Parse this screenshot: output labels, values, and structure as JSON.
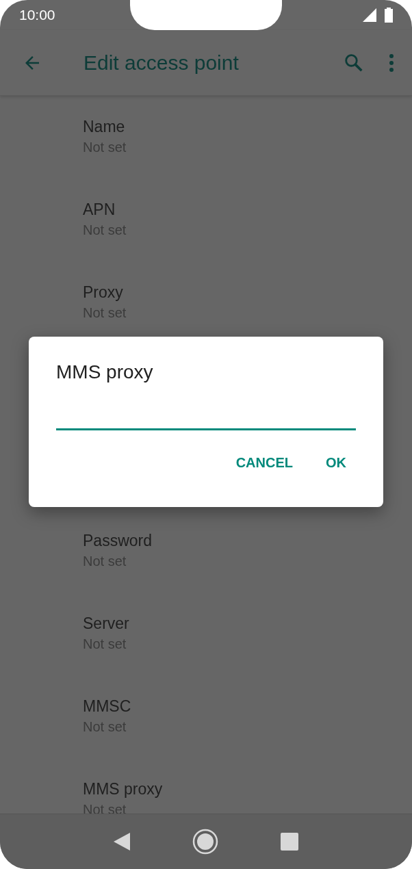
{
  "status_bar": {
    "time": "10:00"
  },
  "app_bar": {
    "title": "Edit access point"
  },
  "settings_above_dialog": [
    {
      "label": "Name",
      "value": "Not set"
    },
    {
      "label": "APN",
      "value": "Not set"
    },
    {
      "label": "Proxy",
      "value": "Not set"
    }
  ],
  "settings_below_dialog": [
    {
      "label": "Password",
      "value": "Not set"
    },
    {
      "label": "Server",
      "value": "Not set"
    },
    {
      "label": "MMSC",
      "value": "Not set"
    },
    {
      "label": "MMS proxy",
      "value": "Not set"
    }
  ],
  "dialog": {
    "title": "MMS proxy",
    "input": {
      "focused": true
    },
    "buttons": [
      "CANCEL",
      "OK"
    ]
  }
}
